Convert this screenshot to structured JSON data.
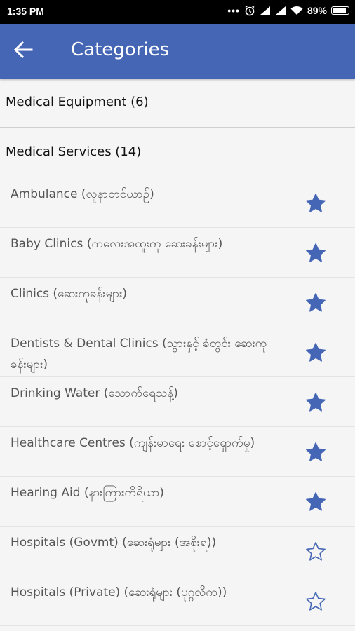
{
  "status": {
    "time": "1:35 PM",
    "battery": "89%"
  },
  "appbar": {
    "title": "Categories",
    "back_icon": "arrow-back-icon"
  },
  "groups": [
    {
      "label": "Medical Equipment (6)"
    },
    {
      "label": "Medical Services (14)"
    }
  ],
  "items": [
    {
      "label": "Ambulance (လူနာတင်ယာဉ်)",
      "favorite": true
    },
    {
      "label": "Baby Clinics (ကလေးအထူးကု ဆေးခန်းများ)",
      "favorite": true
    },
    {
      "label": "Clinics (ဆေးကုခန်းများ)",
      "favorite": true
    },
    {
      "label": "Dentists & Dental Clinics (သွားနှင့် ခံတွင်း ဆေးကုခန်းများ)",
      "favorite": true
    },
    {
      "label": "Drinking Water (သောက်ရေသန့်)",
      "favorite": true
    },
    {
      "label": "Healthcare Centres (ကျန်းမာရေး စောင့်ရှောက်မှု)",
      "favorite": true
    },
    {
      "label": "Hearing Aid (နားကြားကိရိယာ)",
      "favorite": true
    },
    {
      "label": "Hospitals (Govmt) (ဆေးရုံများ (အစိုးရ))",
      "favorite": false
    },
    {
      "label": "Hospitals (Private) (ဆေးရုံများ (ပုဂ္ဂလိက))",
      "favorite": false
    }
  ],
  "colors": {
    "appbar": "#4466b5",
    "star": "#4466b5"
  }
}
